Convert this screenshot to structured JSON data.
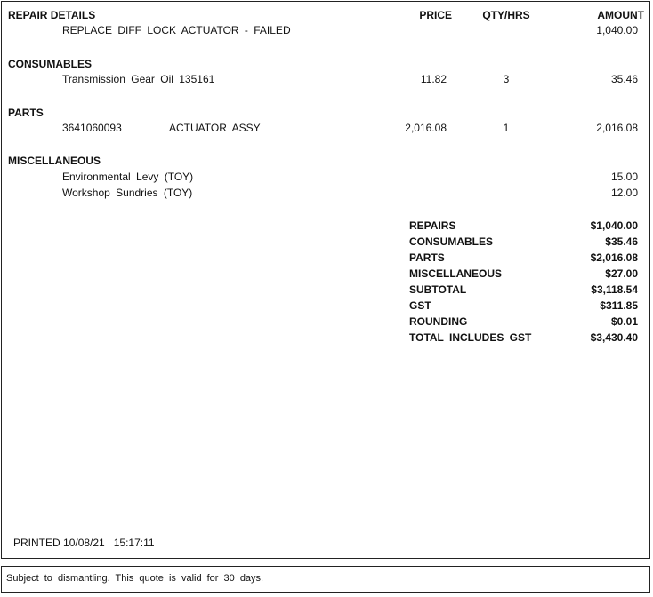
{
  "header": {
    "section": "REPAIR DETAILS",
    "price": "PRICE",
    "qty": "QTY/HRS",
    "amount": "AMOUNT"
  },
  "repair": {
    "description": "REPLACE DIFF LOCK ACTUATOR - FAILED",
    "amount": "1,040.00"
  },
  "consumables": {
    "title": "CONSUMABLES",
    "items": [
      {
        "description": "Transmission Gear Oil 135161",
        "price": "11.82",
        "qty": "3",
        "amount": "35.46"
      }
    ]
  },
  "parts": {
    "title": "PARTS",
    "items": [
      {
        "part_number": "3641060093",
        "description": "ACTUATOR ASSY",
        "price": "2,016.08",
        "qty": "1",
        "amount": "2,016.08"
      }
    ]
  },
  "miscellaneous": {
    "title": "MISCELLANEOUS",
    "items": [
      {
        "description": "Environmental Levy (TOY)",
        "amount": "15.00"
      },
      {
        "description": "Workshop Sundries (TOY)",
        "amount": "12.00"
      }
    ]
  },
  "totals": [
    {
      "label": "REPAIRS",
      "value": "$1,040.00"
    },
    {
      "label": "CONSUMABLES",
      "value": "$35.46"
    },
    {
      "label": "PARTS",
      "value": "$2,016.08"
    },
    {
      "label": "MISCELLANEOUS",
      "value": "$27.00"
    },
    {
      "label": "SUBTOTAL",
      "value": "$3,118.54"
    },
    {
      "label": "GST",
      "value": "$311.85"
    },
    {
      "label": "ROUNDING",
      "value": "$0.01"
    },
    {
      "label": "TOTAL INCLUDES GST",
      "value": "$3,430.40"
    }
  ],
  "printed": {
    "label": "PRINTED",
    "date": "10/08/21",
    "time": "15:17:11"
  },
  "footer": {
    "note": "Subject to dismantling. This quote is valid for 30 days."
  }
}
